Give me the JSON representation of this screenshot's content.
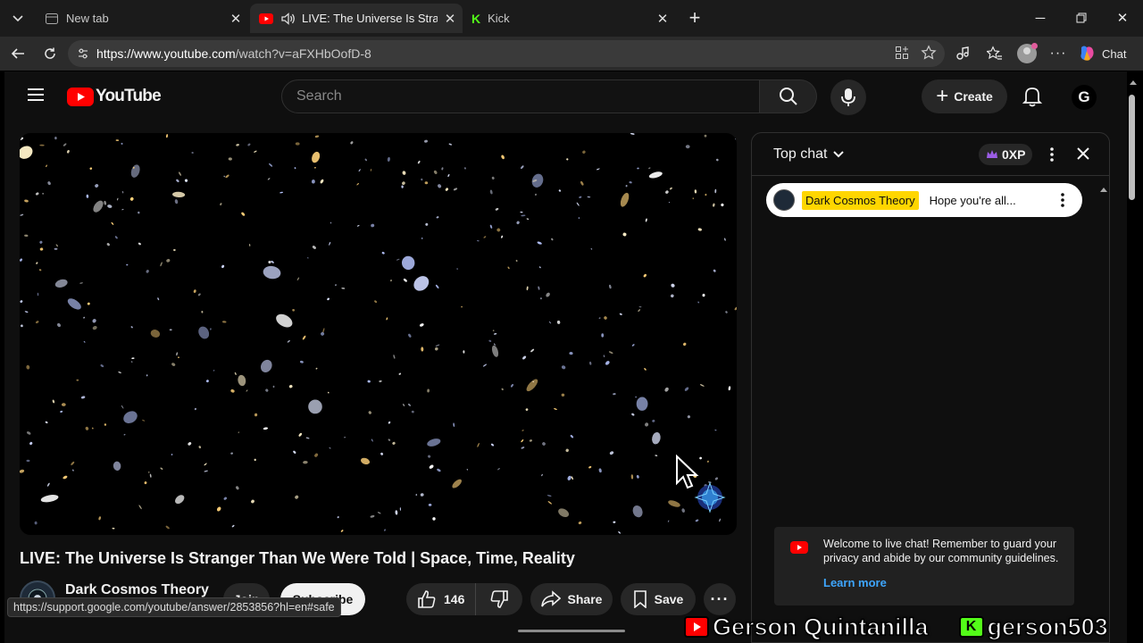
{
  "browser": {
    "tabs": [
      {
        "title": "New tab",
        "active": false
      },
      {
        "title": "LIVE: The Universe Is Stranger",
        "active": true
      },
      {
        "title": "Kick",
        "active": false
      }
    ],
    "url_host": "https://www.youtube.com",
    "url_path": "/watch?v=aFXHbOofD-8",
    "copilot_label": "Chat"
  },
  "youtube": {
    "logo_text": "YouTube",
    "search_placeholder": "Search",
    "create_label": "Create",
    "avatar_letter": "G",
    "video_title": "LIVE: The Universe Is Stranger Than We Were Told | Space, Time, Reality",
    "channel_name": "Dark Cosmos Theory",
    "join_label": "Join",
    "subscribe_label": "Subscribe",
    "like_count": "146",
    "share_label": "Share",
    "save_label": "Save",
    "status_url": "https://support.google.com/youtube/answer/2853856?hl=en#safe"
  },
  "chat": {
    "mode_label": "Top chat",
    "xp_label": "0XP",
    "pinned_author": "Dark Cosmos Theory",
    "pinned_text": "Hope you're all...",
    "welcome_text": "Welcome to live chat! Remember to guard your privacy and abide by our community guidelines.",
    "learn_more": "Learn more"
  },
  "overlay": {
    "youtube_name": "Gerson Quintanilla",
    "kick_name": "gerson503"
  },
  "colors": {
    "yt_red": "#ff0000",
    "chat_highlight": "#ffd600",
    "link_blue": "#3ea6ff",
    "kick_green": "#53fc18"
  }
}
